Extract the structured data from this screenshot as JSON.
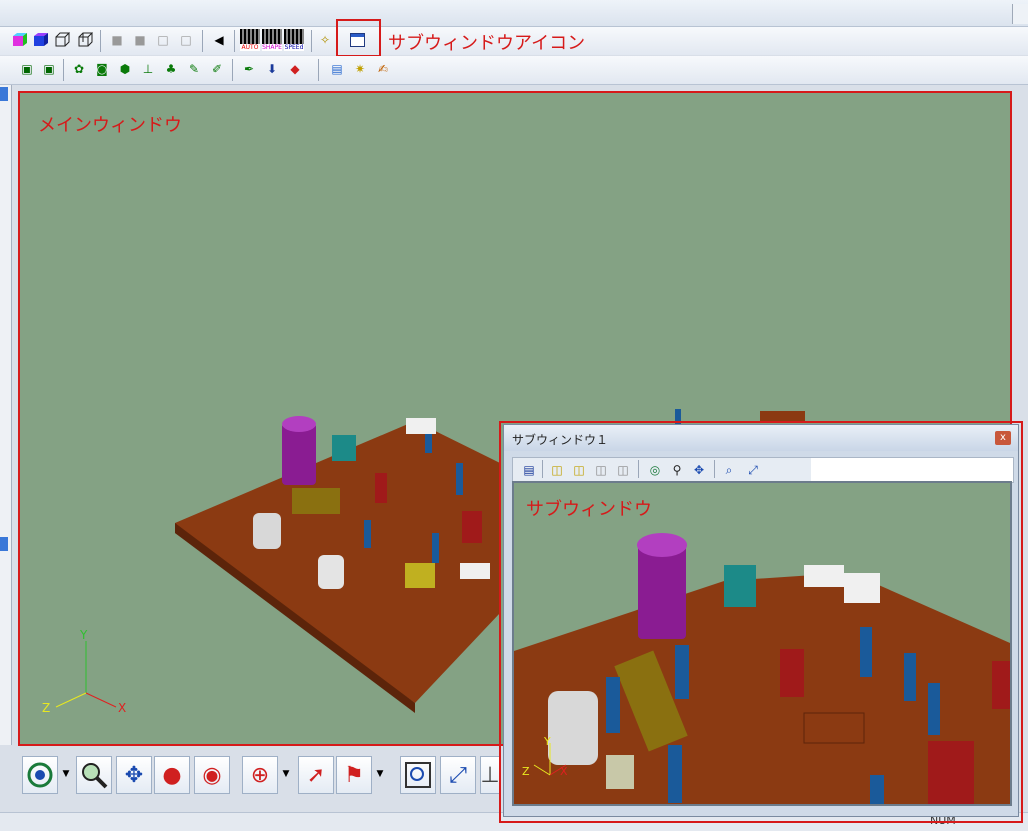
{
  "colors": {
    "viewport_bg": "#84a284",
    "board": "#8b3a12",
    "annotation_red": "#d61a1a",
    "toolbar_bg": "#e2e8f1"
  },
  "toolbar_row1": {
    "auto_label": "AUTO",
    "shape_label": "SHAPE",
    "speed_label": "SPEEd",
    "subwindow_icon_caption": "サブウィンドウアイコン"
  },
  "main_window": {
    "caption": "メインウィンドウ",
    "axes": {
      "y": "Y",
      "x": "X",
      "z": "Z"
    }
  },
  "sub_window": {
    "title": "サブウィンドウ１",
    "close": "x",
    "caption": "サブウィンドウ",
    "axes": {
      "y": "Y",
      "x": "X",
      "z": "Z"
    }
  },
  "status": {
    "text": "NUM"
  },
  "icons": {
    "row1": [
      "cube-colored-icon",
      "cube-blue-icon",
      "wireframe-icon",
      "wireframe2-icon",
      "shade1-icon",
      "shade2-icon",
      "shade3-icon",
      "shade4-icon",
      "back-icon",
      "auto-icon",
      "shape-icon",
      "speed-icon",
      "wand-icon",
      "window-icon"
    ],
    "row2": [
      "layer1-icon",
      "layer2-icon",
      "camera-icon",
      "camera2-icon",
      "chip-icon",
      "probe-icon",
      "part-icon",
      "pen-icon",
      "pen2-icon",
      "stamp-icon",
      "paint-icon",
      "image-icon",
      "image2-icon",
      "color-icon"
    ],
    "bottom": [
      "rotate-icon",
      "zoom-icon",
      "pan-icon",
      "spin-icon",
      "orbit-icon",
      "target-icon",
      "select-icon",
      "pick-icon",
      "fit-icon",
      "fullscreen-icon"
    ]
  }
}
